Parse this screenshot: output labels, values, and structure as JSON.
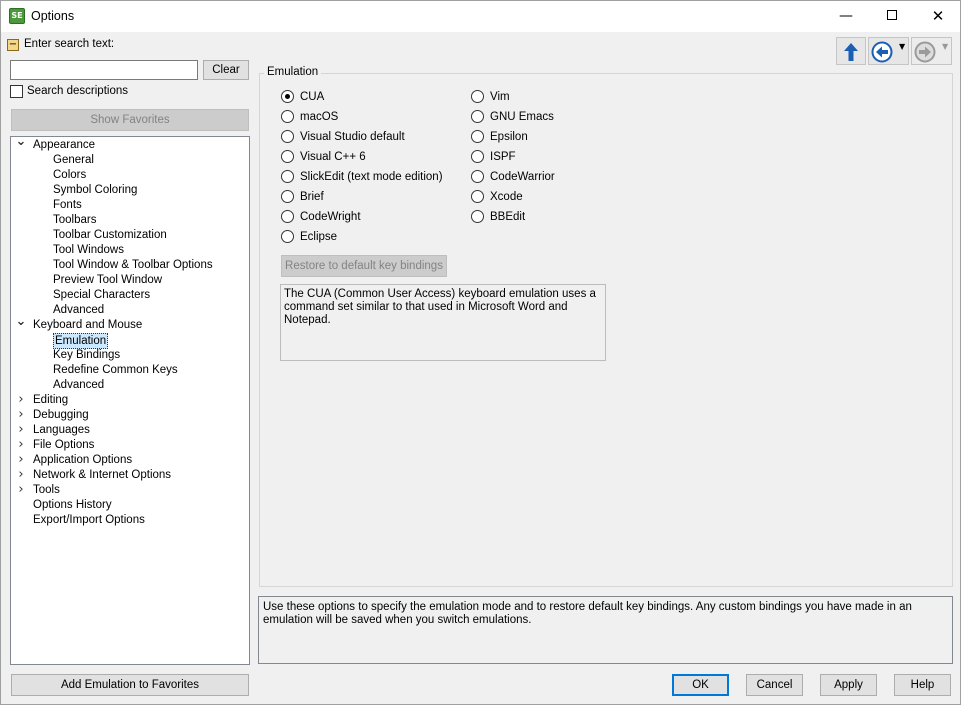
{
  "window": {
    "title": "Options",
    "app_icon_text": "SE",
    "minimize_glyph": "—",
    "close_glyph": "✕"
  },
  "search": {
    "toggle_glyph": "−",
    "label": "Enter search text:",
    "value": "",
    "placeholder": "",
    "clear_label": "Clear",
    "descriptions_label": "Search descriptions",
    "descriptions_checked": false,
    "show_favorites_label": "Show Favorites"
  },
  "tree": {
    "items": [
      {
        "label": "Appearance",
        "level": 0,
        "expanded": true,
        "has_children": true
      },
      {
        "label": "General",
        "level": 1
      },
      {
        "label": "Colors",
        "level": 1
      },
      {
        "label": "Symbol Coloring",
        "level": 1
      },
      {
        "label": "Fonts",
        "level": 1
      },
      {
        "label": "Toolbars",
        "level": 1
      },
      {
        "label": "Toolbar Customization",
        "level": 1
      },
      {
        "label": "Tool Windows",
        "level": 1
      },
      {
        "label": "Tool Window & Toolbar Options",
        "level": 1
      },
      {
        "label": "Preview Tool Window",
        "level": 1
      },
      {
        "label": "Special Characters",
        "level": 1
      },
      {
        "label": "Advanced",
        "level": 1
      },
      {
        "label": "Keyboard and Mouse",
        "level": 0,
        "expanded": true,
        "has_children": true
      },
      {
        "label": "Emulation",
        "level": 1,
        "selected": true
      },
      {
        "label": "Key Bindings",
        "level": 1
      },
      {
        "label": "Redefine Common Keys",
        "level": 1
      },
      {
        "label": "Advanced",
        "level": 1
      },
      {
        "label": "Editing",
        "level": 0,
        "expanded": false,
        "has_children": true
      },
      {
        "label": "Debugging",
        "level": 0,
        "expanded": false,
        "has_children": true
      },
      {
        "label": "Languages",
        "level": 0,
        "expanded": false,
        "has_children": true
      },
      {
        "label": "File Options",
        "level": 0,
        "expanded": false,
        "has_children": true
      },
      {
        "label": "Application Options",
        "level": 0,
        "expanded": false,
        "has_children": true
      },
      {
        "label": "Network & Internet Options",
        "level": 0,
        "expanded": false,
        "has_children": true
      },
      {
        "label": "Tools",
        "level": 0,
        "expanded": false,
        "has_children": true
      },
      {
        "label": "Options History",
        "level": 0,
        "has_children": false
      },
      {
        "label": "Export/Import Options",
        "level": 0,
        "has_children": false
      }
    ]
  },
  "add_favorite_label": "Add Emulation to Favorites",
  "nav": {
    "up_icon": "arrow-up-icon",
    "back_icon": "arrow-left-circle-icon",
    "forward_icon": "arrow-right-circle-icon",
    "accent": "#1a5fb4"
  },
  "emulation": {
    "legend": "Emulation",
    "column1": [
      "CUA",
      "macOS",
      "Visual Studio default",
      "Visual C++ 6",
      "SlickEdit (text mode edition)",
      "Brief",
      "CodeWright",
      "Eclipse"
    ],
    "column2": [
      "Vim",
      "GNU Emacs",
      "Epsilon",
      "ISPF",
      "CodeWarrior",
      "Xcode",
      "BBEdit"
    ],
    "selected": "CUA",
    "restore_label": "Restore to default key bindings",
    "description": "The CUA (Common User Access) keyboard emulation uses a command set similar to that used in Microsoft Word and Notepad."
  },
  "help_text": "Use these options to specify the emulation mode and to restore default key bindings. Any custom bindings you have made in an emulation will be saved when you switch emulations.",
  "buttons": {
    "ok": "OK",
    "cancel": "Cancel",
    "apply": "Apply",
    "help": "Help"
  }
}
